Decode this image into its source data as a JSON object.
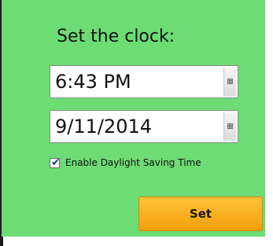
{
  "title": "Set the clock:",
  "time_field": {
    "value": "6:43 PM",
    "button_icon": "picker-grid-icon"
  },
  "date_field": {
    "value": "9/11/2014",
    "button_icon": "picker-grid-icon"
  },
  "daylight_saving": {
    "label": "Enable Daylight Saving Time",
    "checked": true,
    "check_glyph": "✔"
  },
  "set_button": {
    "label": "Set"
  },
  "colors": {
    "panel_background": "#6ddc74",
    "button_top": "#ffc23a",
    "button_bottom": "#f39f0c"
  }
}
